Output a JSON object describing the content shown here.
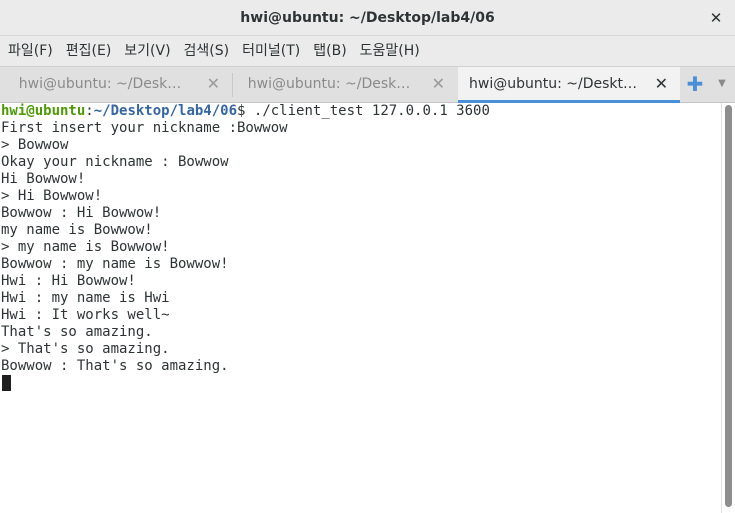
{
  "window": {
    "title": "hwi@ubuntu: ~/Desktop/lab4/06",
    "close_label": "✕"
  },
  "menu": [
    "파일(F)",
    "편집(E)",
    "보기(V)",
    "검색(S)",
    "터미널(T)",
    "탭(B)",
    "도움말(H)"
  ],
  "tabs": [
    {
      "label": "hwi@ubuntu: ~/Desk…",
      "close": "✕",
      "active": false
    },
    {
      "label": "hwi@ubuntu: ~/Desk…",
      "close": "✕",
      "active": false
    },
    {
      "label": "hwi@ubuntu: ~/Deskt…",
      "close": "✕",
      "active": true
    }
  ],
  "tab_controls": {
    "new_tab": "✚",
    "menu": "▼"
  },
  "terminal": {
    "prompt": {
      "user": "hwi@ubuntu",
      "colon": ":",
      "path": "~/Desktop/lab4/06",
      "symbol": "$ ",
      "command": "./client_test 127.0.0.1 3600"
    },
    "lines": [
      "First insert your nickname :Bowwow",
      "> Bowwow",
      "Okay your nickname : Bowwow",
      "Hi Bowwow!",
      "> Hi Bowwow!",
      "Bowwow : Hi Bowwow!",
      "my name is Bowwow!",
      "> my name is Bowwow!",
      "Bowwow : my name is Bowwow!",
      "Hwi : Hi Bowwow!",
      "Hwi : my name is Hwi",
      "Hwi : It works well~",
      "That's so amazing.",
      "> That's so amazing.",
      "Bowwow : That's so amazing."
    ]
  },
  "colors": {
    "prompt_user": "#4e9a06",
    "prompt_path": "#3465a4",
    "active_tab_accent": "#4a90d9"
  }
}
